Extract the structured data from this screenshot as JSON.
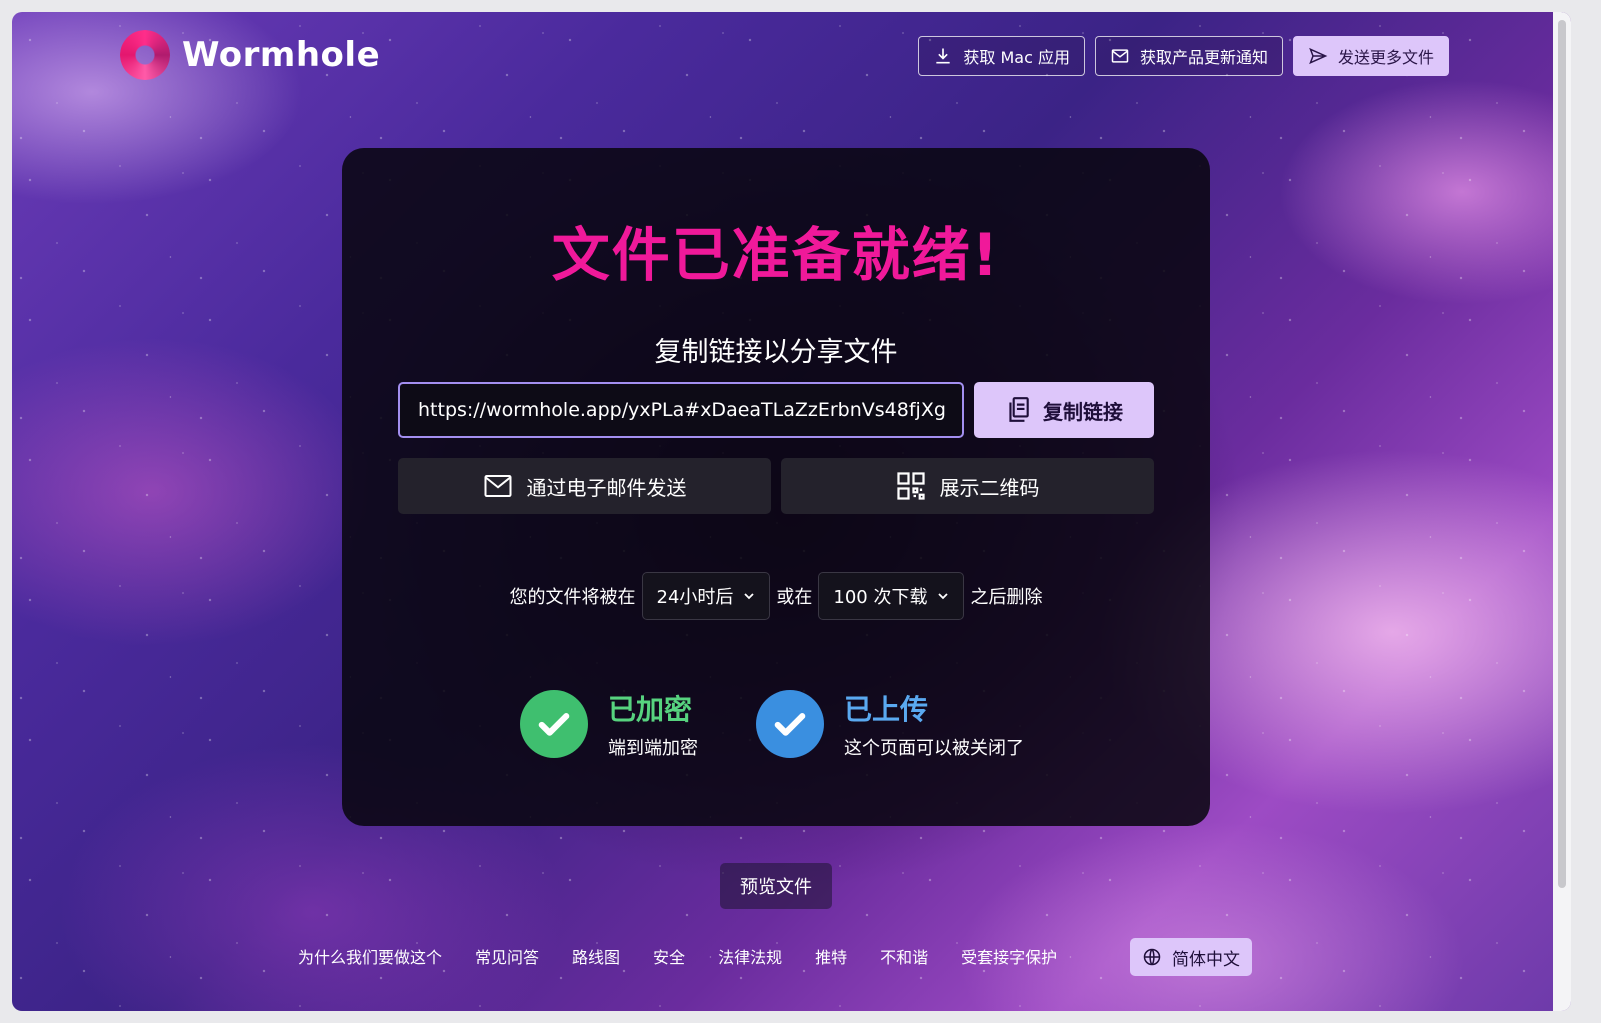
{
  "brand": {
    "name": "Wormhole"
  },
  "header": {
    "get_mac_app": "获取 Mac 应用",
    "get_updates": "获取产品更新通知",
    "send_more": "发送更多文件"
  },
  "card": {
    "title": "文件已准备就绪!",
    "subtitle": "复制链接以分享文件",
    "link_value": "https://wormhole.app/yxPLa#xDaeaTLaZzErbnVs48fjXg",
    "copy_label": "复制链接",
    "email_label": "通过电子邮件发送",
    "qr_label": "展示二维码",
    "expiry": {
      "prefix": "您的文件将被在",
      "time_value": "24小时后",
      "middle": "或在",
      "downloads_value": "100 次下载",
      "suffix": "之后删除"
    },
    "status": {
      "encrypted_title": "已加密",
      "encrypted_sub": "端到端加密",
      "uploaded_title": "已上传",
      "uploaded_sub": "这个页面可以被关闭了"
    }
  },
  "preview_label": "预览文件",
  "footer": {
    "links": [
      "为什么我们要做这个",
      "常见问答",
      "路线图",
      "安全",
      "法律法规",
      "推特",
      "不和谐",
      "受套接字保护"
    ],
    "language": "简体中文"
  },
  "colors": {
    "accent_pink": "#f0199a",
    "button_lavender": "#ddc6fa",
    "status_green": "#3fbf6f",
    "status_blue": "#3a8fe0"
  },
  "icons": [
    "download-icon",
    "mail-icon",
    "send-icon",
    "copy-icon",
    "qr-code-icon",
    "chevron-down-icon",
    "check-icon",
    "globe-icon"
  ]
}
